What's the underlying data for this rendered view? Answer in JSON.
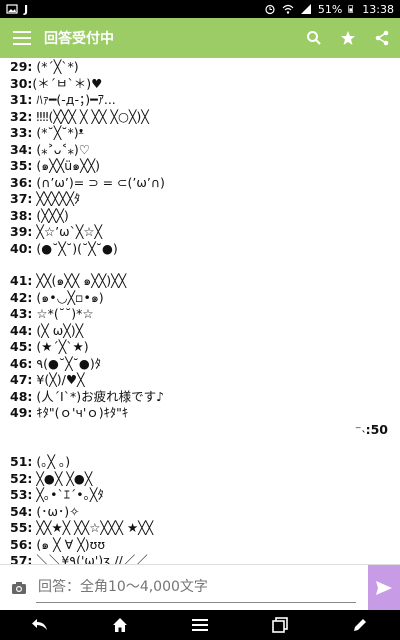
{
  "status_bar": {
    "battery": "51%",
    "time": "13:38",
    "app_letter": "J"
  },
  "app_bar": {
    "title": "回答受付中"
  },
  "answers": [
    {
      "num": "29:",
      "text": "(*´╳`*)"
    },
    {
      "num": "30:",
      "text": "(＊´ㅂ`＊)♥"
    },
    {
      "num": "31:",
      "text": "ﾊｧ━(-д-；)━ｱ..."
    },
    {
      "num": "32:",
      "text": "‼‼(╳╳╳ ╳ ╳╳ ╳○╳)╳"
    },
    {
      "num": "33:",
      "text": "(*˘╳˘*)ᵜ"
    },
    {
      "num": "34:",
      "text": "(⁎˃ᴗ˂⁎)♡"
    },
    {
      "num": "35:",
      "text": "(๑╳╳ü๑╳╳)"
    },
    {
      "num": "36:",
      "text": "(∩’ω’)= ⊃ = ⊂(’ω’∩)"
    },
    {
      "num": "37:",
      "text": "╳╳╳╳╳ﾀ"
    },
    {
      "num": "38:",
      "text": "(╳╳╳)"
    },
    {
      "num": "39:",
      "text": "╳☆’ω`╳☆╳"
    },
    {
      "num": "40:",
      "text": "(●˘╳˘)(˘╳˘●)"
    },
    {
      "num": "41:",
      "text": "╳╳(๑╳╳ ๑╳╳)╳╳"
    },
    {
      "num": "42:",
      "text": "(๑•◡╳▫•๑)"
    },
    {
      "num": "43:",
      "text": "☆*(˘˘)*☆"
    },
    {
      "num": "44:",
      "text": "(╳ ω╳)╳"
    },
    {
      "num": "45:",
      "text": "(★´╳`★)"
    },
    {
      "num": "46:",
      "text": "٩(●˘╳˘●)ﾀ"
    },
    {
      "num": "47:",
      "text": "¥(╳)/♥╳"
    },
    {
      "num": "48:",
      "text": "(人´Ι`*)お疲れ様です♪"
    },
    {
      "num": "49:",
      "text": "ｷﾀ\"(ｏ'ч'ｏ)ｷﾀ\"ｷ"
    },
    {
      "num": "51:",
      "text": "(｡╳ ｡)"
    },
    {
      "num": "52:",
      "text": "╳●╳ ╳●╳"
    },
    {
      "num": "53:",
      "text": "╳｡•`ｴ´•｡╳ﾀ"
    },
    {
      "num": "54:",
      "text": "(･ω･)✧"
    },
    {
      "num": "55:",
      "text": "╳╳★╳ ╳╳☆╳╳╳ ★╳╳"
    },
    {
      "num": "56:",
      "text": "(๑ ╳ ∀ ╳)ʊʊ"
    },
    {
      "num": "57:",
      "text": "＼＼¥٩('ω')ʒ //／／"
    }
  ],
  "right_answer": {
    "num": ":50",
    "text": "⁻˴"
  },
  "composer": {
    "placeholder": "回答：全角10〜4,000文字"
  }
}
